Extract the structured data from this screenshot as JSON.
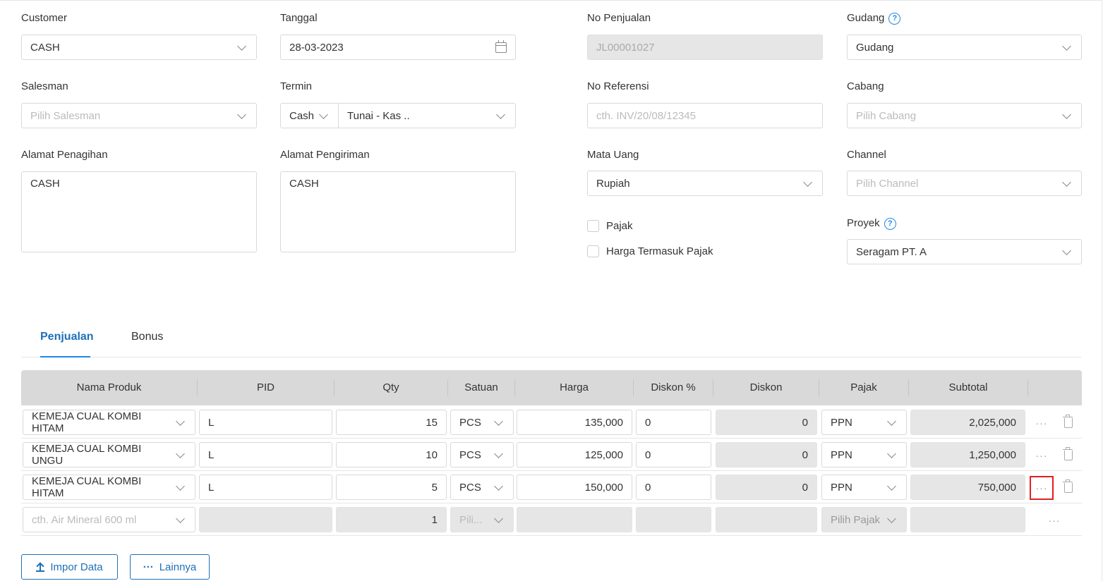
{
  "form": {
    "customer": {
      "label": "Customer",
      "value": "CASH"
    },
    "tanggal": {
      "label": "Tanggal",
      "value": "28-03-2023"
    },
    "no_penjualan": {
      "label": "No Penjualan",
      "value": "JL00001027"
    },
    "gudang": {
      "label": "Gudang",
      "value": "Gudang"
    },
    "salesman": {
      "label": "Salesman",
      "placeholder": "Pilih Salesman"
    },
    "termin": {
      "label": "Termin",
      "type": "Cash",
      "value": "Tunai - Kas .."
    },
    "no_referensi": {
      "label": "No Referensi",
      "placeholder": "cth. INV/20/08/12345"
    },
    "cabang": {
      "label": "Cabang",
      "placeholder": "Pilih Cabang"
    },
    "alamat_penagihan": {
      "label": "Alamat Penagihan",
      "value": "CASH"
    },
    "alamat_pengiriman": {
      "label": "Alamat Pengiriman",
      "value": "CASH"
    },
    "mata_uang": {
      "label": "Mata Uang",
      "value": "Rupiah"
    },
    "channel": {
      "label": "Channel",
      "placeholder": "Pilih Channel"
    },
    "pajak_checkbox": {
      "label": "Pajak"
    },
    "harga_termasuk_pajak": {
      "label": "Harga Termasuk Pajak"
    },
    "proyek": {
      "label": "Proyek",
      "value": "Seragam PT. A"
    }
  },
  "tabs": [
    {
      "label": "Penjualan"
    },
    {
      "label": "Bonus"
    }
  ],
  "table": {
    "headers": [
      "Nama Produk",
      "PID",
      "Qty",
      "Satuan",
      "Harga",
      "Diskon %",
      "Diskon",
      "Pajak",
      "Subtotal"
    ],
    "rows": [
      {
        "produk": "KEMEJA CUAL KOMBI HITAM",
        "pid": "L",
        "qty": "15",
        "satuan": "PCS",
        "harga": "135,000",
        "diskon_pct": "0",
        "diskon": "0",
        "pajak": "PPN",
        "subtotal": "2,025,000"
      },
      {
        "produk": "KEMEJA CUAL KOMBI UNGU",
        "pid": "L",
        "qty": "10",
        "satuan": "PCS",
        "harga": "125,000",
        "diskon_pct": "0",
        "diskon": "0",
        "pajak": "PPN",
        "subtotal": "1,250,000"
      },
      {
        "produk": "KEMEJA CUAL KOMBI HITAM",
        "pid": "L",
        "qty": "5",
        "satuan": "PCS",
        "harga": "150,000",
        "diskon_pct": "0",
        "diskon": "0",
        "pajak": "PPN",
        "subtotal": "750,000"
      }
    ],
    "new_row": {
      "produk_placeholder": "cth. Air Mineral 600 ml",
      "qty": "1",
      "satuan_placeholder": "Pili...",
      "pajak_placeholder": "Pilih Pajak"
    },
    "more_glyph": "···"
  },
  "buttons": {
    "impor": "Impor Data",
    "lainnya": "Lainnya",
    "lainnya_glyph": "···"
  },
  "colors": {
    "accent": "#1e6fb8",
    "highlight": "#e02020"
  }
}
